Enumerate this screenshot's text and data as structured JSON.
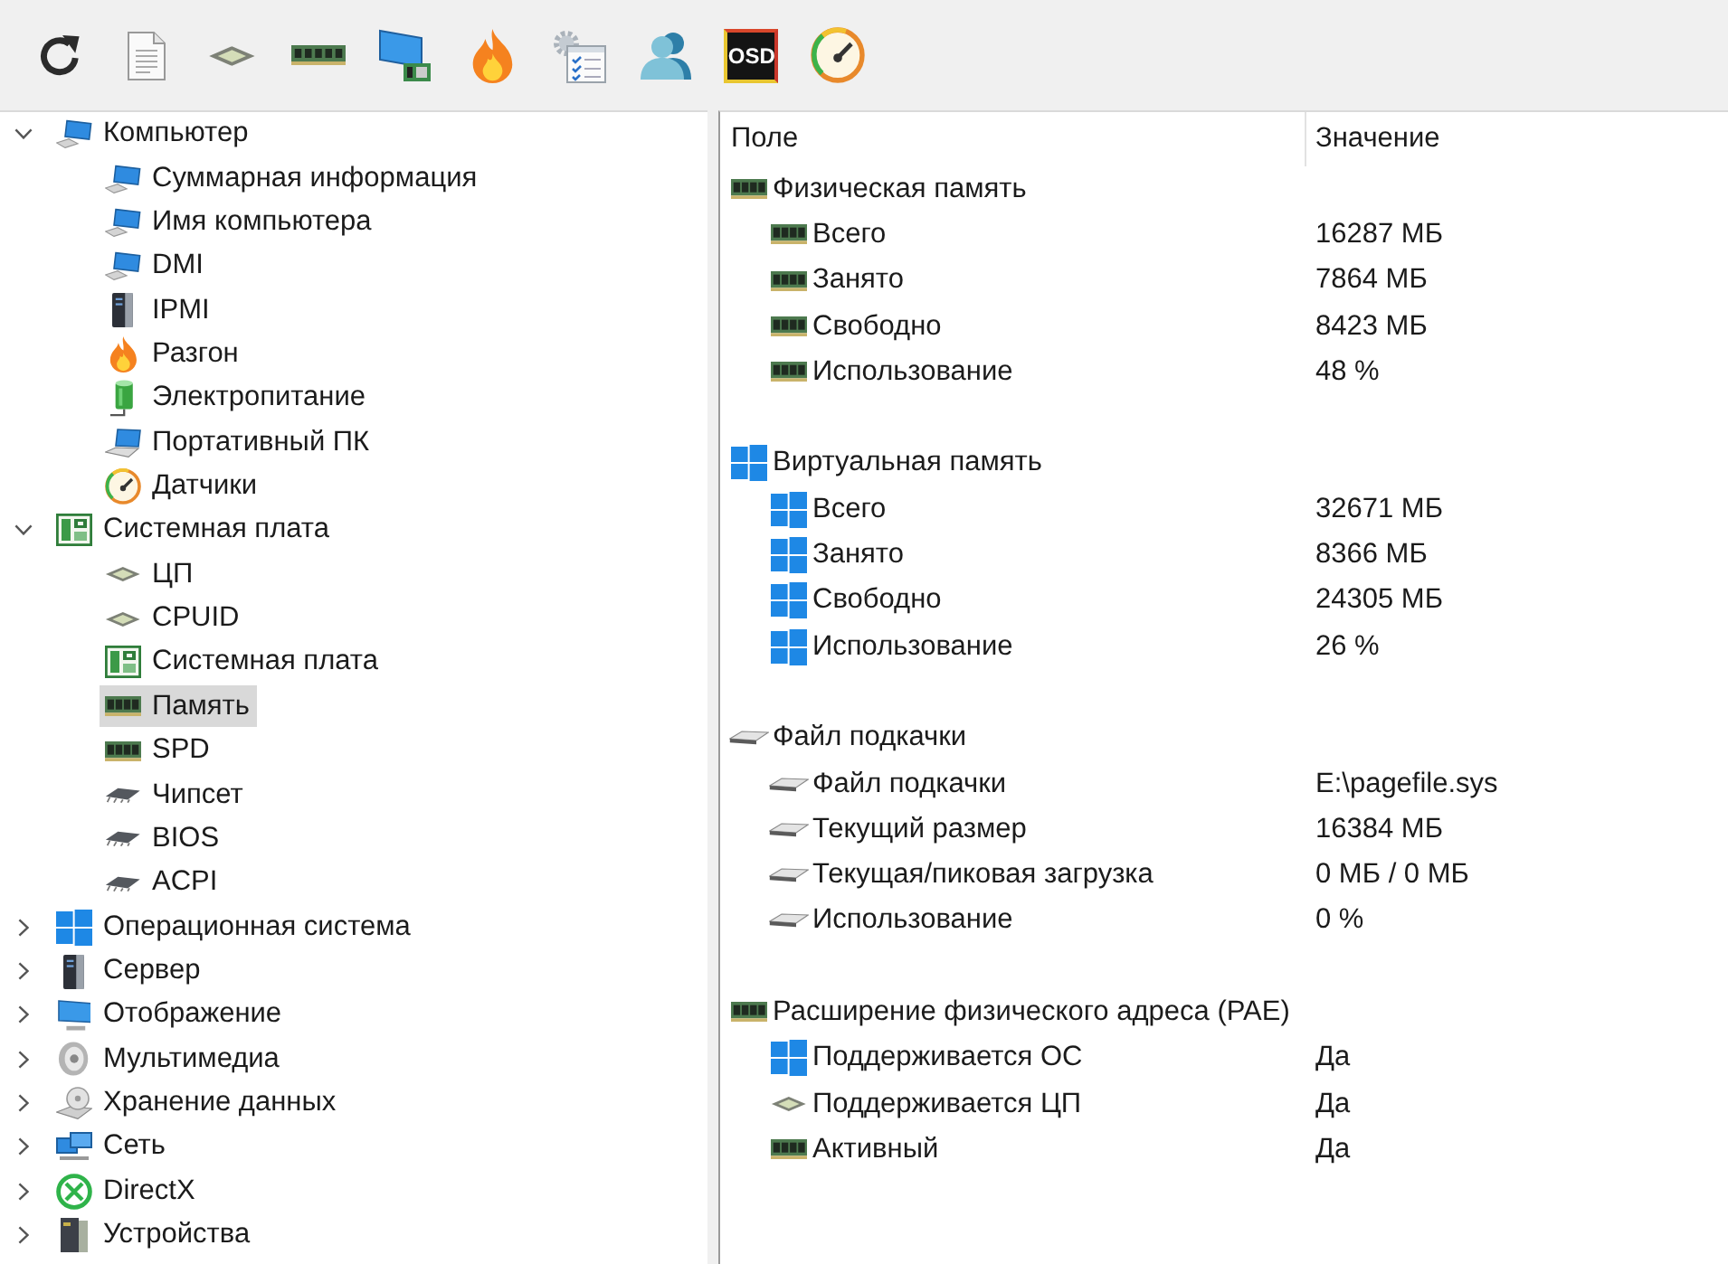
{
  "toolbar": {
    "buttons": [
      {
        "kind": "refresh"
      },
      {
        "kind": "document"
      },
      {
        "kind": "cpu"
      },
      {
        "kind": "ram"
      },
      {
        "kind": "adapter"
      },
      {
        "kind": "flame"
      },
      {
        "kind": "checklist"
      },
      {
        "kind": "user"
      },
      {
        "kind": "osd",
        "label": "OSD"
      },
      {
        "kind": "gauge"
      }
    ]
  },
  "tree": [
    {
      "label": "Компьютер",
      "kind": "computer",
      "expanded": true,
      "selected": false,
      "children": [
        {
          "label": "Суммарная информация",
          "kind": "computer",
          "selected": false
        },
        {
          "label": "Имя компьютера",
          "kind": "computer",
          "selected": false
        },
        {
          "label": "DMI",
          "kind": "computer",
          "selected": false
        },
        {
          "label": "IPMI",
          "kind": "server",
          "selected": false
        },
        {
          "label": "Разгон",
          "kind": "flame",
          "selected": false
        },
        {
          "label": "Электропитание",
          "kind": "battery",
          "selected": false
        },
        {
          "label": "Портативный ПК",
          "kind": "laptop",
          "selected": false
        },
        {
          "label": "Датчики",
          "kind": "gauge",
          "selected": false
        }
      ]
    },
    {
      "label": "Системная плата",
      "kind": "board",
      "expanded": true,
      "selected": false,
      "children": [
        {
          "label": "ЦП",
          "kind": "cpu",
          "selected": false
        },
        {
          "label": "CPUID",
          "kind": "cpu",
          "selected": false
        },
        {
          "label": "Системная плата",
          "kind": "board",
          "selected": false
        },
        {
          "label": "Память",
          "kind": "ram",
          "selected": true
        },
        {
          "label": "SPD",
          "kind": "ram",
          "selected": false
        },
        {
          "label": "Чипсет",
          "kind": "chip",
          "selected": false
        },
        {
          "label": "BIOS",
          "kind": "chip",
          "selected": false
        },
        {
          "label": "ACPI",
          "kind": "chip",
          "selected": false
        }
      ]
    },
    {
      "label": "Операционная система",
      "kind": "windows",
      "expanded": false,
      "selected": false
    },
    {
      "label": "Сервер",
      "kind": "server",
      "expanded": false,
      "selected": false
    },
    {
      "label": "Отображение",
      "kind": "monitor",
      "expanded": false,
      "selected": false
    },
    {
      "label": "Мультимедиа",
      "kind": "speaker",
      "expanded": false,
      "selected": false
    },
    {
      "label": "Хранение данных",
      "kind": "storage",
      "expanded": false,
      "selected": false
    },
    {
      "label": "Сеть",
      "kind": "network",
      "expanded": false,
      "selected": false
    },
    {
      "label": "DirectX",
      "kind": "xbox",
      "expanded": false,
      "selected": false
    },
    {
      "label": "Устройства",
      "kind": "devices",
      "expanded": false,
      "selected": false
    }
  ],
  "list": {
    "columns": [
      "Поле",
      "Значение"
    ],
    "groups": [
      {
        "label": "Физическая память",
        "kind": "ram",
        "items": [
          {
            "label": "Всего",
            "kind": "ram",
            "value": "16287 МБ"
          },
          {
            "label": "Занято",
            "kind": "ram",
            "value": "7864 МБ"
          },
          {
            "label": "Свободно",
            "kind": "ram",
            "value": "8423 МБ"
          },
          {
            "label": "Использование",
            "kind": "ram",
            "value": "48 %"
          }
        ]
      },
      {
        "label": "Виртуальная память",
        "kind": "windows",
        "items": [
          {
            "label": "Всего",
            "kind": "windows",
            "value": "32671 МБ"
          },
          {
            "label": "Занято",
            "kind": "windows",
            "value": "8366 МБ"
          },
          {
            "label": "Свободно",
            "kind": "windows",
            "value": "24305 МБ"
          },
          {
            "label": "Использование",
            "kind": "windows",
            "value": "26 %"
          }
        ]
      },
      {
        "label": "Файл подкачки",
        "kind": "drive",
        "items": [
          {
            "label": "Файл подкачки",
            "kind": "drive",
            "value": "E:\\pagefile.sys"
          },
          {
            "label": "Текущий размер",
            "kind": "drive",
            "value": "16384 МБ"
          },
          {
            "label": "Текущая/пиковая загрузка",
            "kind": "drive",
            "value": "0 МБ / 0 МБ"
          },
          {
            "label": "Использование",
            "kind": "drive",
            "value": "0 %"
          }
        ]
      },
      {
        "label": "Расширение физического адреса (PAE)",
        "kind": "ram",
        "items": [
          {
            "label": "Поддерживается ОС",
            "kind": "windows",
            "value": "Да"
          },
          {
            "label": "Поддерживается ЦП",
            "kind": "cpu",
            "value": "Да"
          },
          {
            "label": "Активный",
            "kind": "ram",
            "value": "Да"
          }
        ]
      }
    ]
  }
}
